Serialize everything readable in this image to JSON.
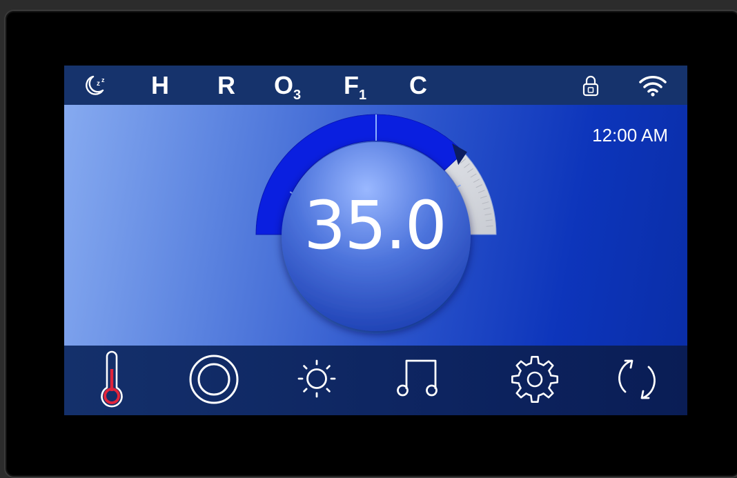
{
  "status_bar": {
    "items": [
      {
        "name": "sleep-mode",
        "icon": "moon-sleep-icon"
      },
      {
        "name": "heat",
        "label": "H"
      },
      {
        "name": "r-indicator",
        "label": "R"
      },
      {
        "name": "ozone",
        "label": "O",
        "sub": "3"
      },
      {
        "name": "filter",
        "label": "F",
        "sub": "1"
      },
      {
        "name": "clean",
        "label": "C"
      },
      {
        "name": "lock",
        "icon": "lock-icon"
      },
      {
        "name": "wifi",
        "icon": "wifi-icon"
      }
    ]
  },
  "main": {
    "time": "12:00 AM",
    "temperature": "35.0",
    "dial_level": 0.76
  },
  "bottom_nav": [
    {
      "name": "temperature",
      "icon": "thermometer-icon"
    },
    {
      "name": "jets",
      "icon": "target-circle-icon"
    },
    {
      "name": "light",
      "icon": "sun-icon"
    },
    {
      "name": "audio",
      "icon": "music-note-icon"
    },
    {
      "name": "settings",
      "icon": "gear-icon"
    },
    {
      "name": "refresh",
      "icon": "refresh-icon"
    }
  ],
  "colors": {
    "status_bg": "#16336c",
    "dial_fill": "#0a1fe0",
    "thermometer_accent": "#e0243b",
    "text": "#ffffff"
  }
}
